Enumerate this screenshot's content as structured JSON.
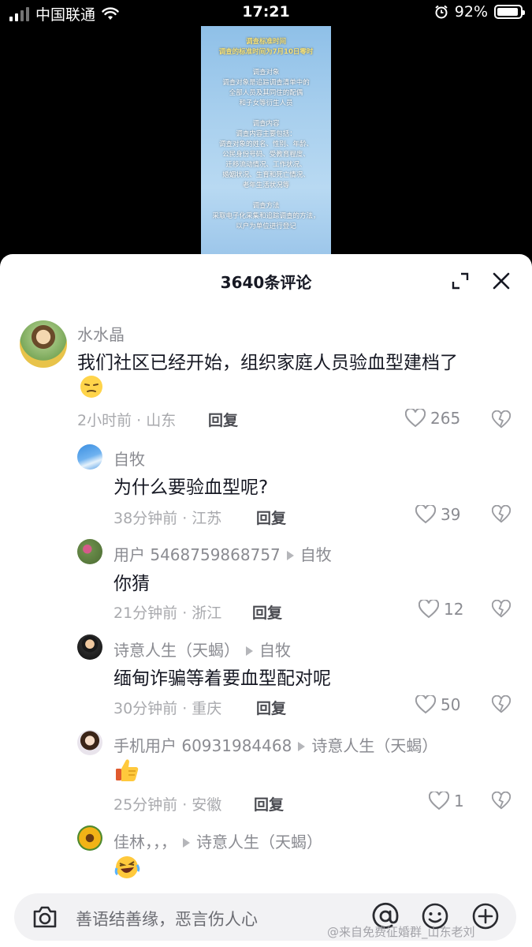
{
  "status": {
    "carrier": "中国联通",
    "time": "17:21",
    "battery": "92%",
    "battery_level": 0.92
  },
  "poster": {
    "lines": [
      "调查标准时间",
      "调查的标准时间为7月10日零时",
      "",
      "调查对象",
      "调查对象是追踪调查清单中的",
      "全部人员及其同住的配偶",
      "和子女等衍生人员",
      "",
      "调查内容",
      "调查内容主要包括：",
      "调查对象的姓名、性别、年龄、",
      "公民身份号码、受教育程度、",
      "迁移流动情况、工作状况、",
      "婚姻状况、生育和死亡情况、",
      "老年生活状况等",
      "",
      "调查方法",
      "采取电子化采集和追踪调查的方法，",
      "以户为单位进行登记"
    ]
  },
  "sheet": {
    "title": "3640条评论"
  },
  "comments": [
    {
      "user": "水水晶",
      "text": "我们社区已经开始，组织家庭人员验血型建档了",
      "meta": "2小时前 · 山东",
      "reply": "回复",
      "likes": "265"
    },
    {
      "user": "自牧",
      "text": "为什么要验血型呢?",
      "meta": "38分钟前 · 江苏",
      "reply": "回复",
      "likes": "39"
    },
    {
      "user": "用户 5468759868757",
      "reply_to": "自牧",
      "text": "你猜",
      "meta": "21分钟前 · 浙江",
      "reply": "回复",
      "likes": "12"
    },
    {
      "user": "诗意人生（天蝎）",
      "reply_to": "自牧",
      "text": "缅甸诈骗等着要血型配对呢",
      "meta": "30分钟前 · 重庆",
      "reply": "回复",
      "likes": "50"
    },
    {
      "user": "手机用户 60931984468",
      "reply_to": "诗意人生（天蝎）",
      "text": "",
      "meta": "25分钟前 · 安徽",
      "reply": "回复",
      "likes": "1"
    },
    {
      "user": "佳林，，，",
      "reply_to": "诗意人生（天蝎）",
      "text": ""
    }
  ],
  "input": {
    "placeholder": "善语结善缘，恶言伤人心"
  },
  "watermark": "@来自免费征婚群_山东老刘",
  "colors": {
    "sheet_bg": "#ffffff",
    "input_bg": "#f2f2f4",
    "primary_text": "#161823",
    "secondary_text": "#8a8b91"
  }
}
